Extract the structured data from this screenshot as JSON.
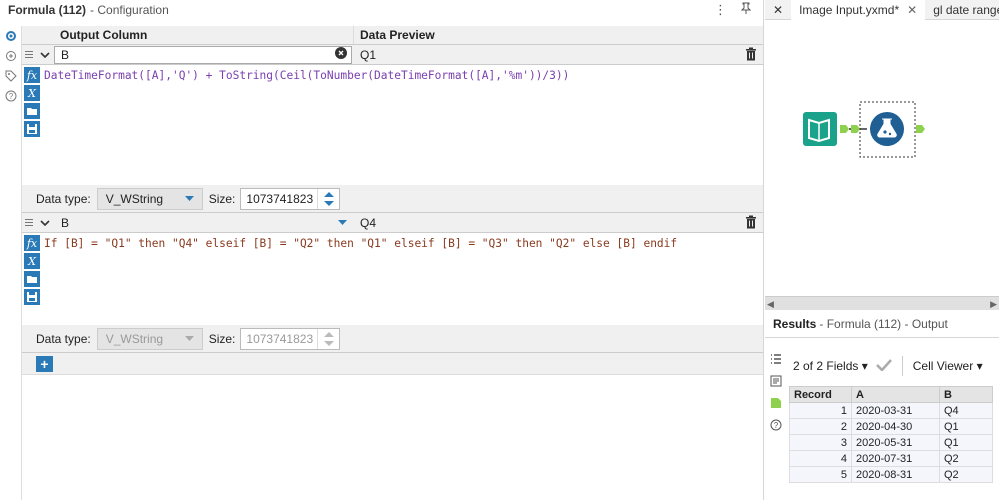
{
  "left_panel": {
    "title": "Formula (112)",
    "subtitle": "- Configuration",
    "headers": {
      "output_column": "Output Column",
      "data_preview": "Data Preview"
    },
    "formulas": [
      {
        "output": "B",
        "preview": "Q1",
        "expression": "DateTimeFormat([A],'Q') + ToString(Ceil(ToNumber(DateTimeFormat([A],'%m'))/3))",
        "data_type_label": "Data type:",
        "data_type": "V_WString",
        "size_label": "Size:",
        "size": "1073741823"
      },
      {
        "output": "B",
        "preview": "Q4",
        "expression": "If [B] = \"Q1\" then \"Q4\" elseif [B] = \"Q2\" then \"Q1\" elseif [B] = \"Q3\" then \"Q2\" else [B] endif",
        "data_type_label": "Data type:",
        "data_type": "V_WString",
        "size_label": "Size:",
        "size": "1073741823"
      }
    ],
    "add_button": "+"
  },
  "right_panel": {
    "tabs": [
      {
        "label": "Image Input.yxmd*"
      },
      {
        "label": "gl date range.y"
      }
    ],
    "results": {
      "title": "Results",
      "subtitle": "- Formula (112) - Output",
      "fields_label": "2 of 2 Fields",
      "viewer_label": "Cell Viewer",
      "columns": [
        "Record",
        "A",
        "B"
      ],
      "rows": [
        [
          "1",
          "2020-03-31",
          "Q4"
        ],
        [
          "2",
          "2020-04-30",
          "Q1"
        ],
        [
          "3",
          "2020-05-31",
          "Q1"
        ],
        [
          "4",
          "2020-07-31",
          "Q2"
        ],
        [
          "5",
          "2020-08-31",
          "Q2"
        ]
      ]
    }
  },
  "colors": {
    "accent": "#2a7ab8",
    "tool_teal": "#1aa38a",
    "tool_blue": "#1f5f93",
    "connector_green": "#8fd14f"
  }
}
